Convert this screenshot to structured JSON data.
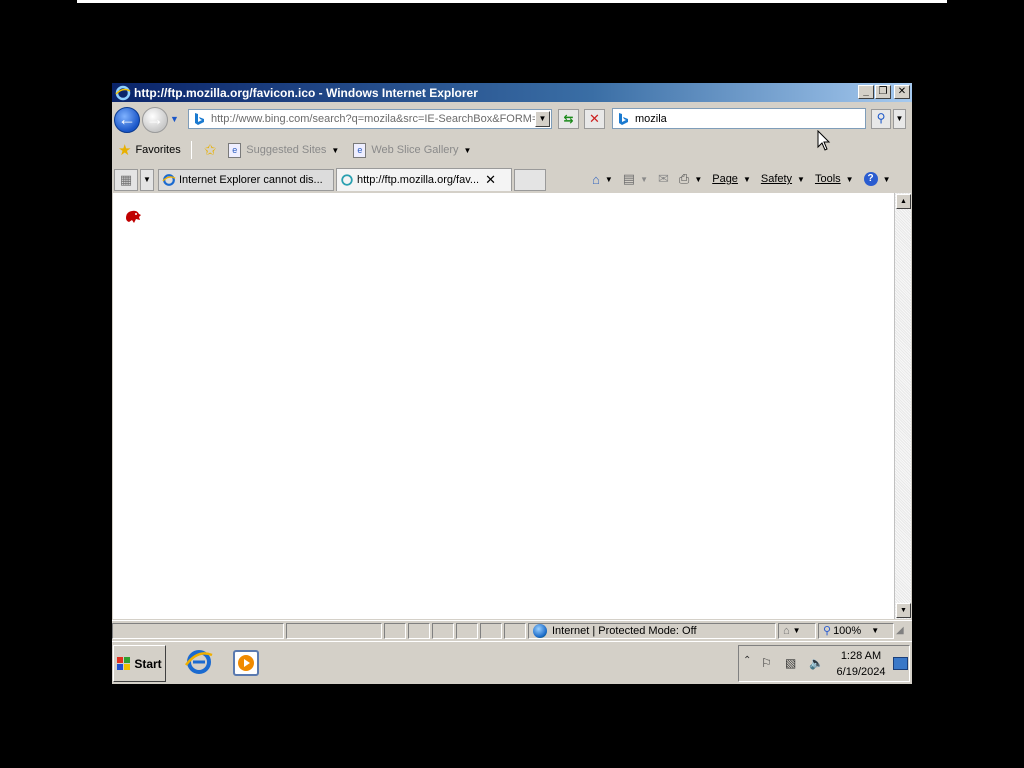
{
  "window": {
    "title": "http://ftp.mozilla.org/favicon.ico - Windows Internet Explorer",
    "controls": {
      "minimize": "_",
      "restore": "❐",
      "close": "✕"
    }
  },
  "address_bar": {
    "url": "http://www.bing.com/search?q=mozila&src=IE-SearchBox&FORM=",
    "dropdown": "▼"
  },
  "search": {
    "value": "mozila"
  },
  "favorites_bar": {
    "favorites_label": "Favorites",
    "items": [
      {
        "label": "Suggested Sites"
      },
      {
        "label": "Web Slice Gallery"
      }
    ]
  },
  "tabs": [
    {
      "label": "Internet Explorer cannot dis..."
    },
    {
      "label": "http://ftp.mozilla.org/fav..."
    }
  ],
  "command_bar": {
    "page": "Page",
    "safety": "Safety",
    "tools": "Tools"
  },
  "statusbar": {
    "zone": "Internet | Protected Mode: Off",
    "zoom": "100%"
  },
  "taskbar": {
    "start_label": "Start",
    "time": "1:28 AM",
    "date": "6/19/2024"
  },
  "icons": {
    "back": "back-arrow-icon",
    "forward": "forward-arrow-icon",
    "refresh": "refresh-icon",
    "stop": "stop-icon",
    "search": "search-icon",
    "home": "home-icon",
    "feeds": "rss-feed-icon",
    "mail": "mail-icon",
    "print": "print-icon",
    "help": "help-icon"
  },
  "colors": {
    "titlebar_start": "#0a246a",
    "titlebar_end": "#a6caf0",
    "chrome": "#d4d0c8",
    "favicon": "#c00000"
  }
}
